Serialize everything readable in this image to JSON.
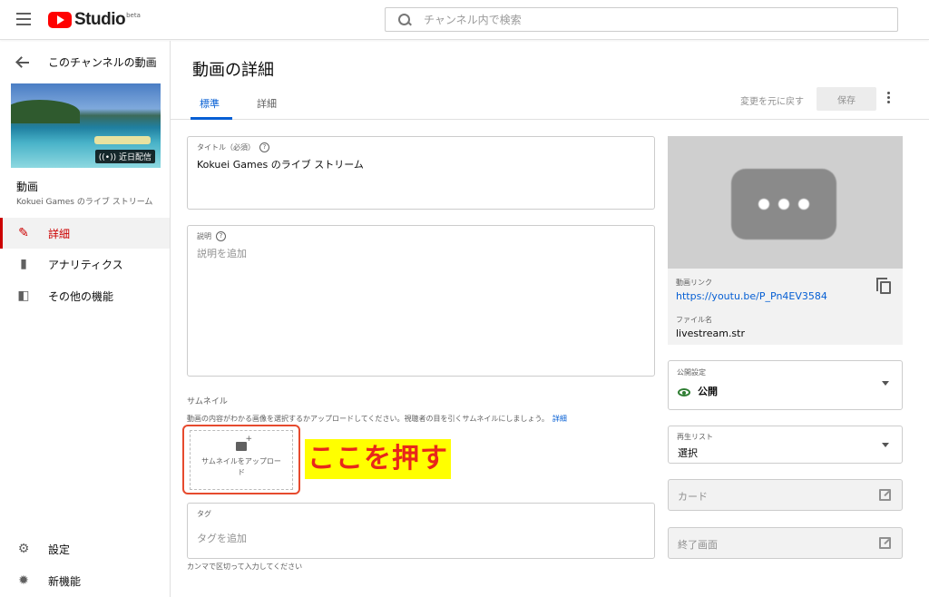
{
  "app": {
    "logo_text": "Studio",
    "logo_beta": "beta",
    "search_placeholder": "チャンネル内で検索"
  },
  "sidebar": {
    "back_label": "このチャンネルの動画",
    "thumbnail_badge": "((•)) 近日配信",
    "video_section_title": "動画",
    "video_title": "Kokuei Games のライブ ストリーム",
    "nav": [
      {
        "label": "詳細",
        "icon": "pencil-icon",
        "active": true
      },
      {
        "label": "アナリティクス",
        "icon": "analytics-icon",
        "active": false
      },
      {
        "label": "その他の機能",
        "icon": "more-features-icon",
        "active": false
      }
    ],
    "bottom": [
      {
        "label": "設定",
        "icon": "gear-icon"
      },
      {
        "label": "新機能",
        "icon": "new-features-icon"
      }
    ]
  },
  "main": {
    "title": "動画の詳細",
    "tabs": [
      {
        "label": "標準",
        "active": true
      },
      {
        "label": "詳細",
        "active": false
      }
    ],
    "revert_label": "変更を元に戻す",
    "save_label": "保存",
    "title_field": {
      "label": "タイトル（必須）",
      "value": "Kokuei Games のライブ ストリーム"
    },
    "description_field": {
      "label": "説明",
      "placeholder": "説明を追加"
    },
    "thumbnail": {
      "label": "サムネイル",
      "description": "動画の内容がわかる画像を選択するかアップロードしてください。視聴者の目を引くサムネイルにしましょう。",
      "link": "詳細",
      "upload_label": "サムネイルをアップロード"
    },
    "callout": "ここを押す",
    "tags_field": {
      "label": "タグ",
      "placeholder": "タグを追加",
      "help": "カンマで区切って入力してください"
    }
  },
  "right": {
    "video_link_label": "動画リンク",
    "video_link": "https://youtu.be/P_Pn4EV3584",
    "file_name_label": "ファイル名",
    "file_name": "livestream.str",
    "visibility": {
      "label": "公開設定",
      "value": "公開"
    },
    "playlist": {
      "label": "再生リスト",
      "value": "選択"
    },
    "cards_label": "カード",
    "end_screen_label": "終了画面"
  },
  "colors": {
    "accent_red": "#cc0000",
    "link_blue": "#065fd4",
    "callout_bg": "#ffff00",
    "callout_text": "#e8261b",
    "public_green": "#2e7d32"
  }
}
